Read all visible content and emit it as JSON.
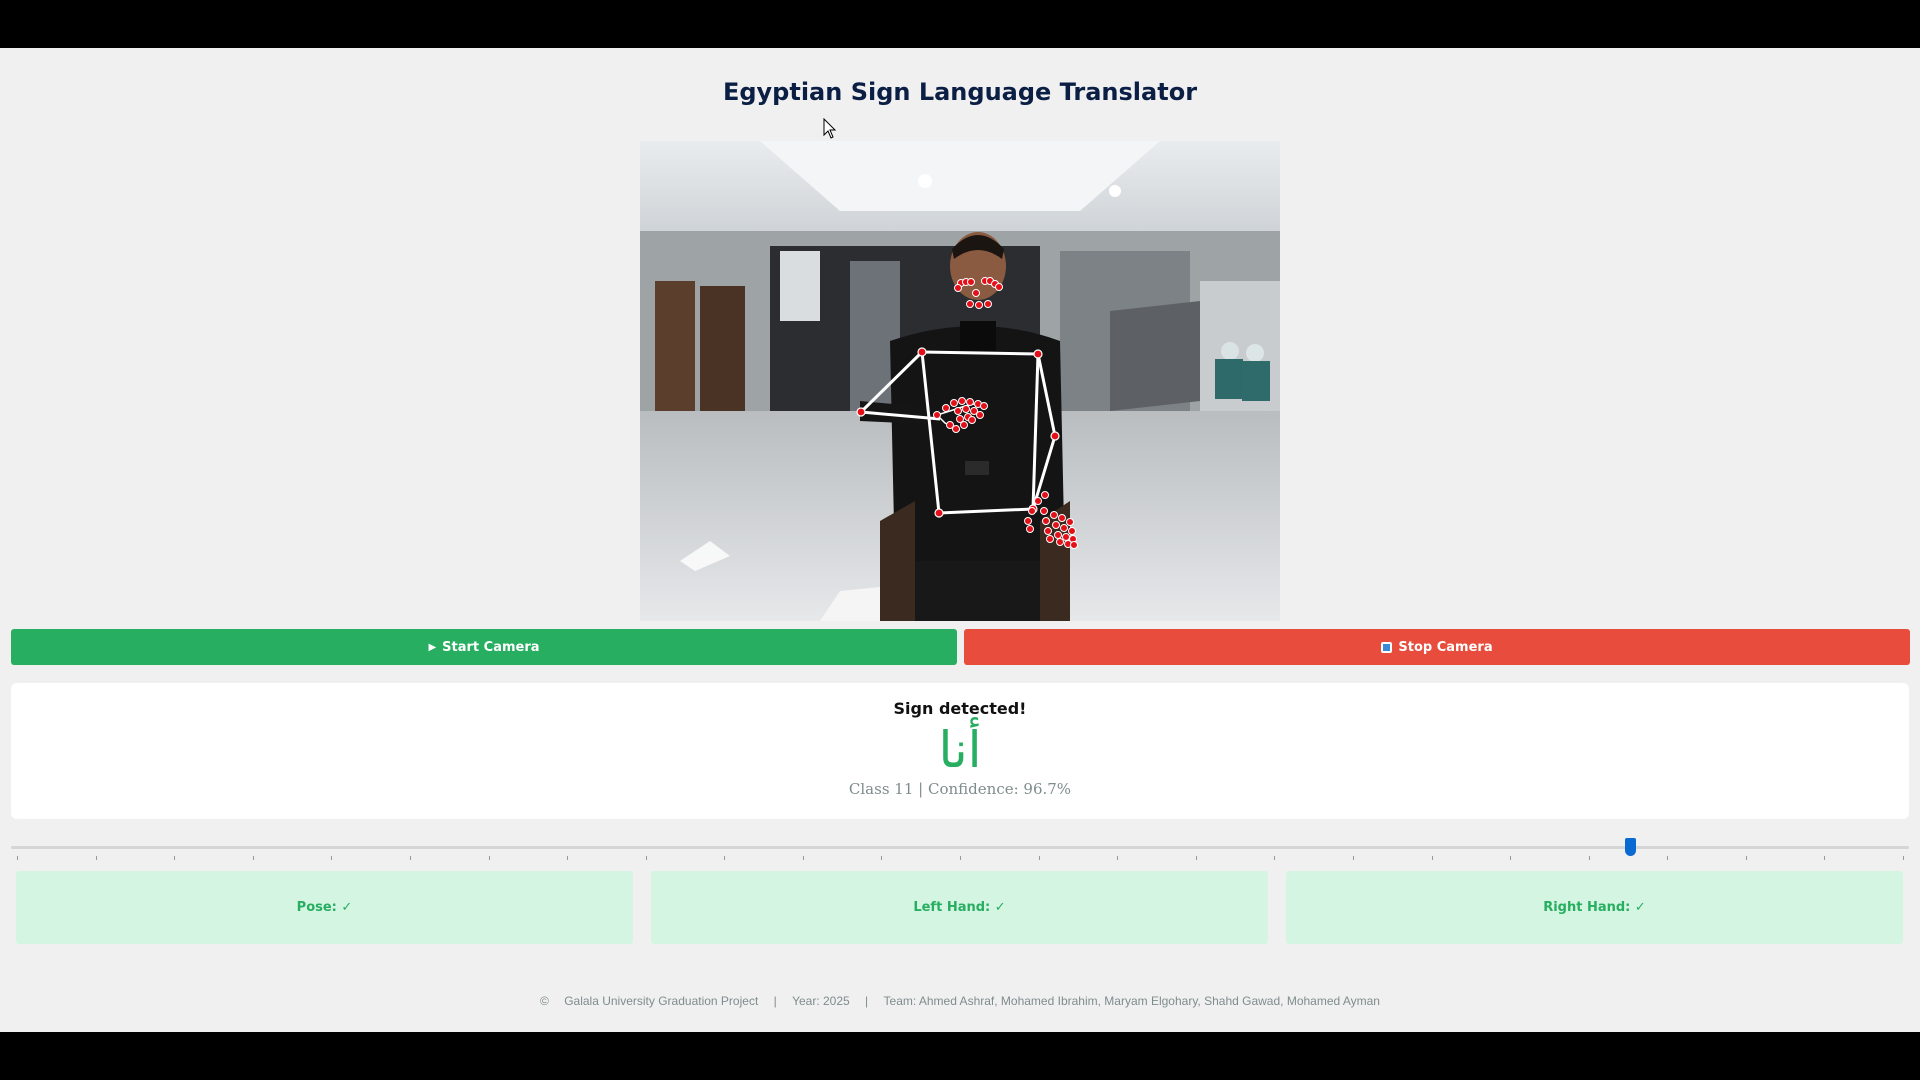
{
  "app": {
    "title": "Egyptian Sign Language Translator"
  },
  "controls": {
    "start_label": "Start Camera",
    "stop_label": "Stop Camera",
    "start_icon": "play-icon",
    "stop_icon": "stop-icon"
  },
  "result": {
    "status": "Sign detected!",
    "sign": "أنا",
    "class_label": "Class 11",
    "separator": "|",
    "confidence_label": "Confidence: 96.7%"
  },
  "slider": {
    "value_fraction": 0.853
  },
  "tracking": [
    {
      "label": "Pose: ✓"
    },
    {
      "label": "Left Hand: ✓"
    },
    {
      "label": "Right Hand: ✓"
    }
  ],
  "footer": {
    "copyright": "©",
    "project": "Galala University Graduation Project",
    "sep": "|",
    "year": "Year: 2025",
    "team": "Team: Ahmed Ashraf, Mohamed Ibrahim, Maryam Elgohary, Shahd Gawad, Mohamed Ayman"
  },
  "colors": {
    "start": "#27ae60",
    "stop": "#e74c3c",
    "title": "#0b1f44",
    "card_bg": "#d5f5e3",
    "landmark": "#e3101a"
  }
}
